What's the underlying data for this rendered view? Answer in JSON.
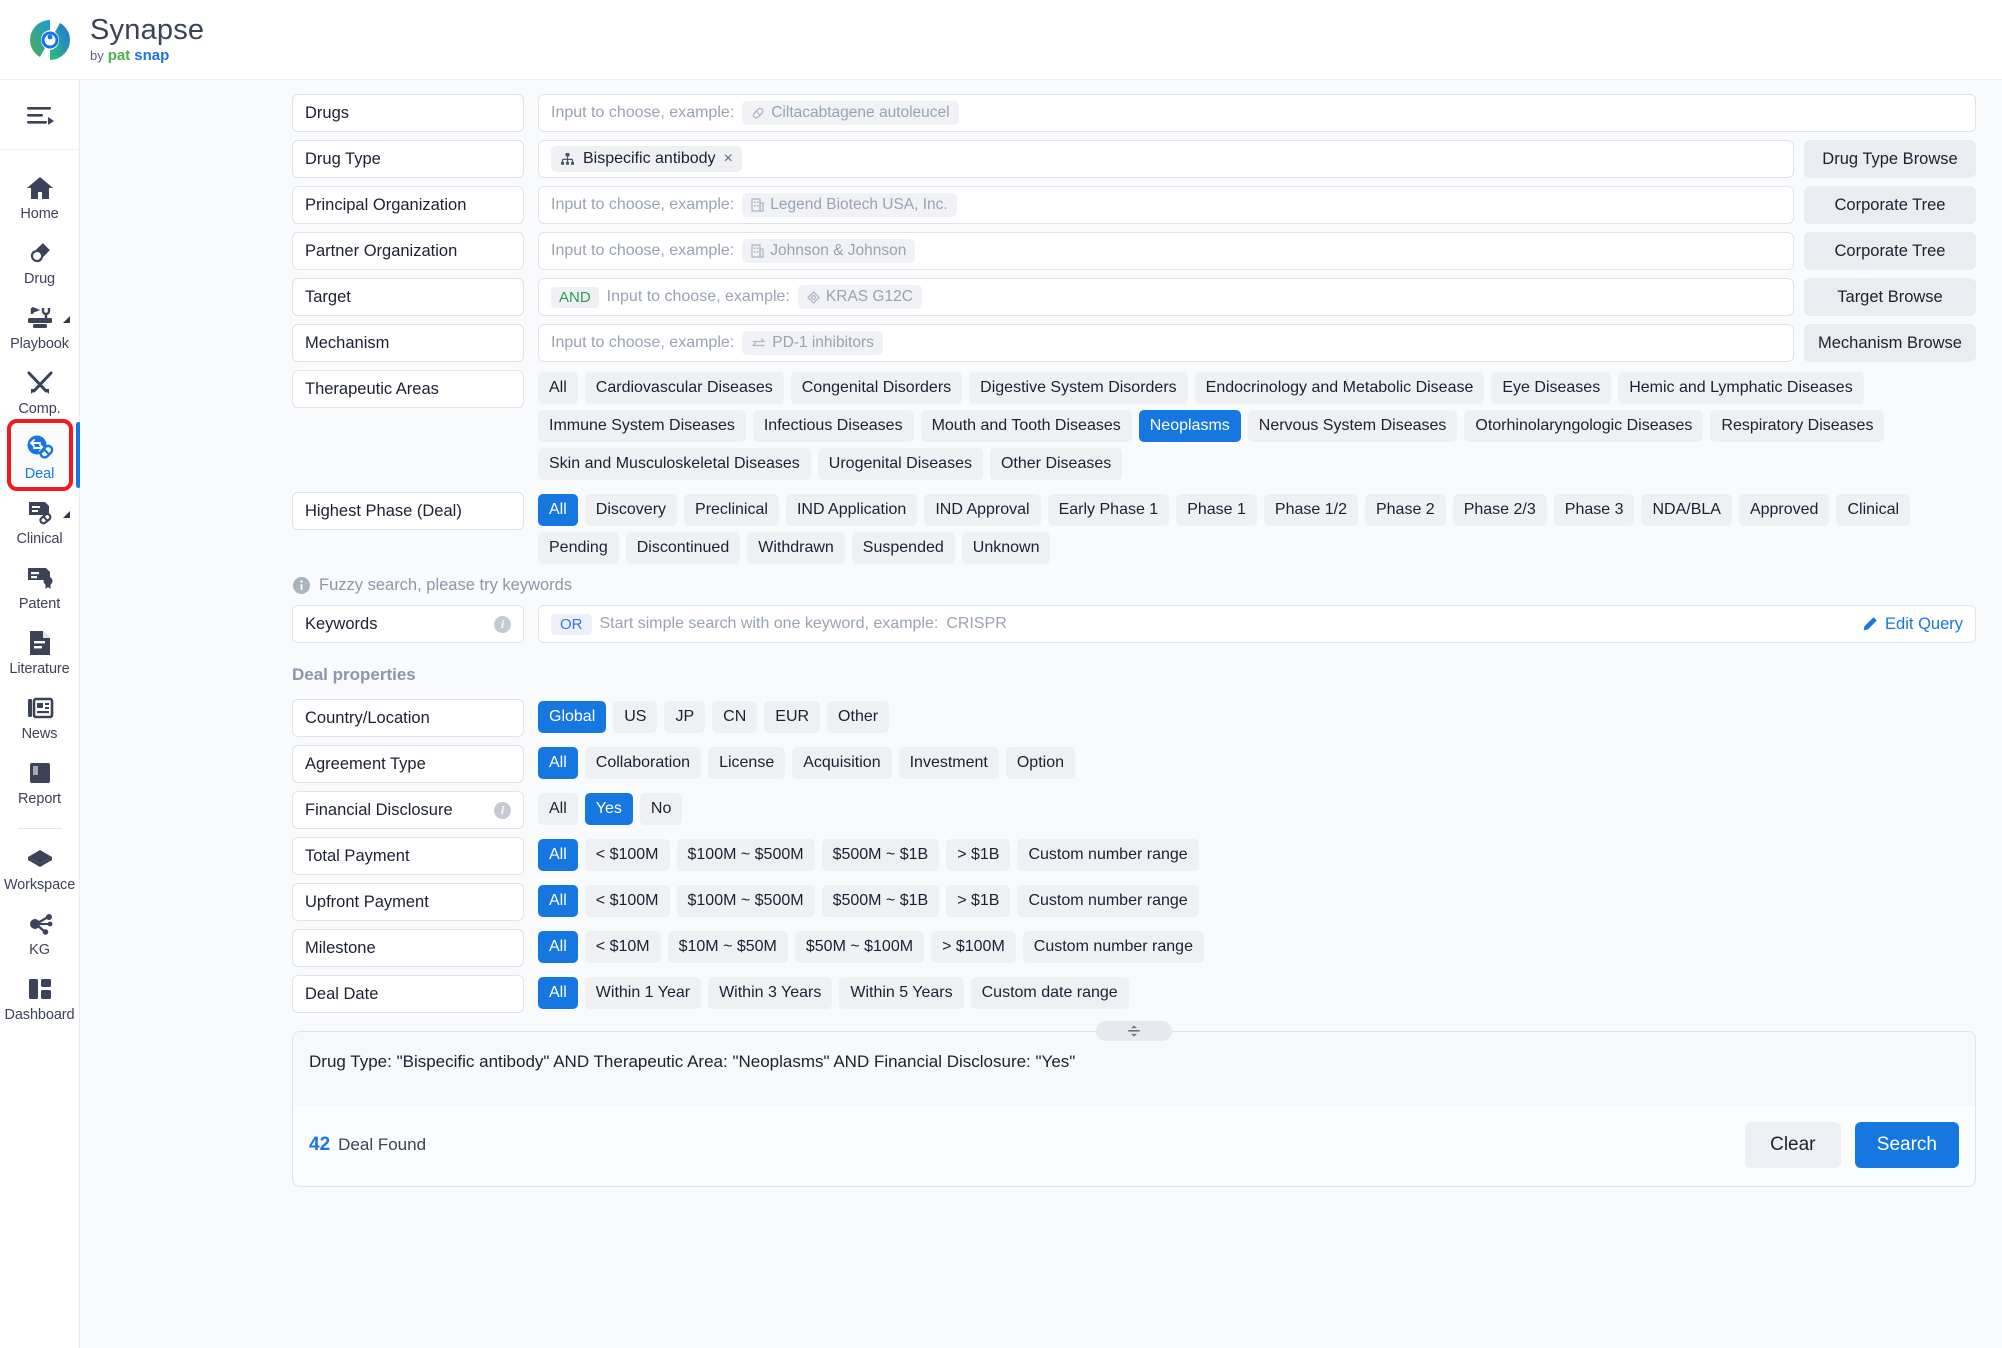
{
  "brand": {
    "title": "Synapse",
    "by": "by",
    "pat": "pat",
    "snap": "snap",
    "logo_icon": "synapse-logo-icon"
  },
  "sidebar": {
    "toggle_icon": "collapse-menu-icon",
    "items": [
      {
        "label": "Home",
        "icon": "home-icon",
        "active": false,
        "caret": false
      },
      {
        "label": "Drug",
        "icon": "capsule-icon",
        "active": false,
        "caret": false
      },
      {
        "label": "Playbook",
        "icon": "playbook-icon",
        "active": false,
        "caret": true
      },
      {
        "label": "Comp.",
        "icon": "swords-icon",
        "active": false,
        "caret": false
      },
      {
        "label": "Deal",
        "icon": "deal-handshake-icon",
        "active": true,
        "caret": false
      },
      {
        "label": "Clinical",
        "icon": "clinical-note-icon",
        "active": false,
        "caret": true
      },
      {
        "label": "Patent",
        "icon": "patent-icon",
        "active": false,
        "caret": false
      },
      {
        "label": "Literature",
        "icon": "literature-icon",
        "active": false,
        "caret": false
      },
      {
        "label": "News",
        "icon": "news-icon",
        "active": false,
        "caret": false
      },
      {
        "label": "Report",
        "icon": "report-book-icon",
        "active": false,
        "caret": false
      },
      {
        "label": "Workspace",
        "icon": "workspace-cube-icon",
        "active": false,
        "caret": false
      },
      {
        "label": "KG",
        "icon": "knowledge-graph-icon",
        "active": false,
        "caret": false
      },
      {
        "label": "Dashboard",
        "icon": "dashboard-grid-icon",
        "active": false,
        "caret": false
      }
    ]
  },
  "form": {
    "drugs": {
      "label": "Drugs",
      "placeholder": "Input to choose, example:",
      "example": "Ciltacabtagene autoleucel",
      "example_icon": "capsule-icon"
    },
    "drug_type": {
      "label": "Drug Type",
      "token": "Bispecific antibody",
      "token_icon": "hierarchy-icon",
      "token_remove": "×",
      "browse": "Drug Type Browse"
    },
    "principal_org": {
      "label": "Principal Organization",
      "placeholder": "Input to choose, example:",
      "example": "Legend Biotech USA, Inc.",
      "example_icon": "building-icon",
      "browse": "Corporate Tree"
    },
    "partner_org": {
      "label": "Partner Organization",
      "placeholder": "Input to choose, example:",
      "example": "Johnson & Johnson",
      "example_icon": "building-icon",
      "browse": "Corporate Tree"
    },
    "target": {
      "label": "Target",
      "operator": "AND",
      "placeholder": "Input to choose, example:",
      "example": "KRAS G12C",
      "example_icon": "target-icon",
      "browse": "Target Browse"
    },
    "mechanism": {
      "label": "Mechanism",
      "placeholder": "Input to choose, example:",
      "example": "PD-1 inhibitors",
      "example_icon": "equilibrium-icon",
      "browse": "Mechanism Browse"
    },
    "therapeutic_areas": {
      "label": "Therapeutic Areas",
      "options": [
        "All",
        "Cardiovascular Diseases",
        "Congenital Disorders",
        "Digestive System Disorders",
        "Endocrinology and Metabolic Disease",
        "Eye Diseases",
        "Hemic and Lymphatic Diseases",
        "Immune System Diseases",
        "Infectious Diseases",
        "Mouth and Tooth Diseases",
        "Neoplasms",
        "Nervous System Diseases",
        "Otorhinolaryngologic Diseases",
        "Respiratory Diseases",
        "Skin and Musculoskeletal Diseases",
        "Urogenital Diseases",
        "Other Diseases"
      ],
      "selected": "Neoplasms"
    },
    "highest_phase": {
      "label": "Highest Phase (Deal)",
      "options": [
        "All",
        "Discovery",
        "Preclinical",
        "IND Application",
        "IND Approval",
        "Early Phase 1",
        "Phase 1",
        "Phase 1/2",
        "Phase 2",
        "Phase 2/3",
        "Phase 3",
        "NDA/BLA",
        "Approved",
        "Clinical",
        "Pending",
        "Discontinued",
        "Withdrawn",
        "Suspended",
        "Unknown"
      ],
      "selected": "All"
    },
    "fuzzy_hint": "Fuzzy search, please try keywords",
    "fuzzy_hint_icon": "info-icon",
    "keywords": {
      "label": "Keywords",
      "operator": "OR",
      "placeholder": "Start simple search with one keyword, example:",
      "example": "CRISPR",
      "edit_query": "Edit Query",
      "edit_query_icon": "pencil-icon"
    }
  },
  "deal_properties": {
    "section_title": "Deal properties",
    "country": {
      "label": "Country/Location",
      "options": [
        "Global",
        "US",
        "JP",
        "CN",
        "EUR",
        "Other"
      ],
      "selected": "Global"
    },
    "agreement_type": {
      "label": "Agreement Type",
      "options": [
        "All",
        "Collaboration",
        "License",
        "Acquisition",
        "Investment",
        "Option"
      ],
      "selected": "All"
    },
    "financial_disclosure": {
      "label": "Financial Disclosure",
      "options": [
        "All",
        "Yes",
        "No"
      ],
      "selected": "Yes"
    },
    "total_payment": {
      "label": "Total Payment",
      "options": [
        "All",
        "< $100M",
        "$100M ~ $500M",
        "$500M ~ $1B",
        "> $1B",
        "Custom number range"
      ],
      "selected": "All"
    },
    "upfront_payment": {
      "label": "Upfront Payment",
      "options": [
        "All",
        "< $100M",
        "$100M ~ $500M",
        "$500M ~ $1B",
        "> $1B",
        "Custom number range"
      ],
      "selected": "All"
    },
    "milestone": {
      "label": "Milestone",
      "options": [
        "All",
        "< $10M",
        "$10M ~ $50M",
        "$50M ~ $100M",
        "> $100M",
        "Custom number range"
      ],
      "selected": "All"
    },
    "deal_date": {
      "label": "Deal Date",
      "options": [
        "All",
        "Within 1 Year",
        "Within 3 Years",
        "Within 5 Years",
        "Custom date range"
      ],
      "selected": "All"
    }
  },
  "summary": {
    "query": "Drug Type: \"Bispecific antibody\" AND Therapeutic Area: \"Neoplasms\" AND Financial Disclosure: \"Yes\"",
    "count": "42",
    "count_label": "Deal Found",
    "clear_label": "Clear",
    "search_label": "Search",
    "drag_handle_icon": "resize-handle-icon"
  },
  "colors": {
    "accent": "#1677e0",
    "chip_bg": "#eef0f4",
    "highlight_ring": "#f5181f",
    "operator_and": "#2e9b57",
    "page_bg": "#f8fafc"
  }
}
